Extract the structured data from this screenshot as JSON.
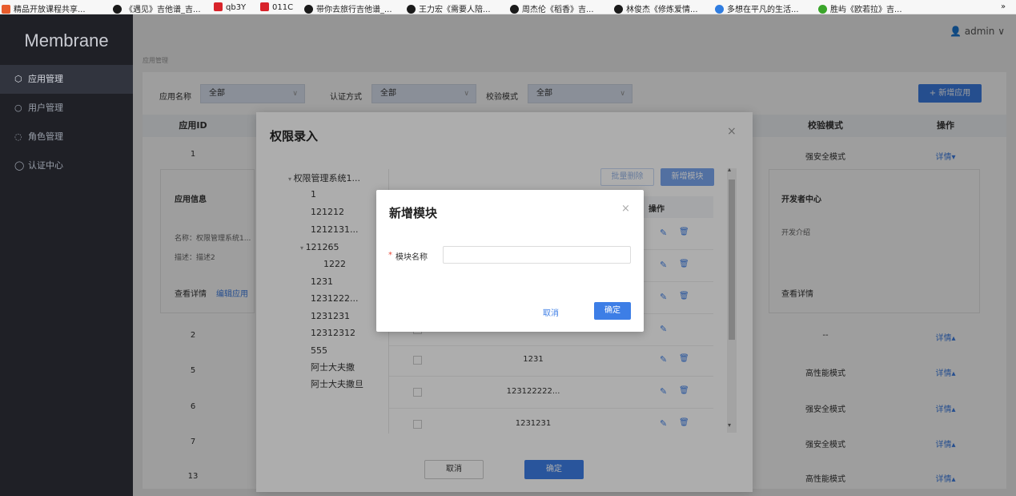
{
  "bookmarks": [
    {
      "label": "精品开放课程共享...",
      "color": "#e85c2c"
    },
    {
      "label": "《遇见》吉他谱_吉...",
      "color": "#1a1a1a"
    },
    {
      "label": "qb3Y",
      "color": "#d8232a"
    },
    {
      "label": "011C",
      "color": "#d8232a"
    },
    {
      "label": "带你去旅行吉他谱_...",
      "color": "#1a1a1a"
    },
    {
      "label": "王力宏《需要人陪...",
      "color": "#1a1a1a"
    },
    {
      "label": "周杰伦《稻香》吉...",
      "color": "#1a1a1a"
    },
    {
      "label": "林俊杰《修炼爱情...",
      "color": "#1a1a1a"
    },
    {
      "label": "多想在平凡的生活...",
      "color": "#2f7de1"
    },
    {
      "label": "胜屿《欧若拉》吉...",
      "color": "#3aa52a"
    }
  ],
  "bookmarks_more": "»",
  "app": {
    "logo": "Membrane",
    "user": "admin"
  },
  "sidebar": [
    {
      "label": "应用管理",
      "icon": "cube-icon"
    },
    {
      "label": "用户管理",
      "icon": "user-icon"
    },
    {
      "label": "角色管理",
      "icon": "users-icon"
    },
    {
      "label": "认证中心",
      "icon": "shield-icon"
    }
  ],
  "breadcrumb": "应用管理",
  "filters": {
    "name_label": "应用名称",
    "name_value": "全部",
    "auth_label": "认证方式",
    "auth_value": "全部",
    "check_label": "校验模式",
    "check_value": "全部"
  },
  "add_app_button": "+ 新增应用",
  "table": {
    "headers": {
      "id": "应用ID",
      "check": "校验模式",
      "op": "操作"
    },
    "rows": [
      {
        "id": "1",
        "mode": "强安全模式",
        "op": "详情▾"
      },
      {
        "id": "2",
        "mode": "--",
        "op": "详情▴"
      },
      {
        "id": "5",
        "mode": "高性能模式",
        "op": "详情▴"
      },
      {
        "id": "6",
        "mode": "强安全模式",
        "op": "详情▴"
      },
      {
        "id": "7",
        "mode": "强安全模式",
        "op": "详情▴"
      },
      {
        "id": "13",
        "mode": "高性能模式",
        "op": "详情▴"
      }
    ]
  },
  "expand": {
    "info_title": "应用信息",
    "name_line": "名称：权限管理系统1...",
    "desc_line": "描述：描述2",
    "view": "查看详情",
    "edit": "编辑应用",
    "dev_title": "开发者中心",
    "dev_intro": "开发介绍",
    "dev_view": "查看详情"
  },
  "perm_modal": {
    "title": "权限录入",
    "close": "×",
    "tree": [
      "权限管理系统1...",
      "1",
      "121212",
      "1212131...",
      "121265",
      "1222",
      "1231",
      "1231222...",
      "1231231",
      "12312312",
      "555",
      "阿士大夫撒",
      "阿士大夫撒旦"
    ],
    "batch_delete": "批量删除",
    "add_module": "新增模块",
    "op_header": "操作",
    "rows": [
      "",
      "",
      "",
      "",
      "1231",
      "123122222...",
      "1231231"
    ],
    "cancel": "取消",
    "ok": "确定"
  },
  "add_modal": {
    "title": "新增模块",
    "close": "×",
    "required": "*",
    "field_label": "模块名称",
    "field_value": "",
    "cancel": "取消",
    "ok": "确定"
  },
  "colors": {
    "primary": "#3d7ee6",
    "sidebar": "#1f2026"
  }
}
